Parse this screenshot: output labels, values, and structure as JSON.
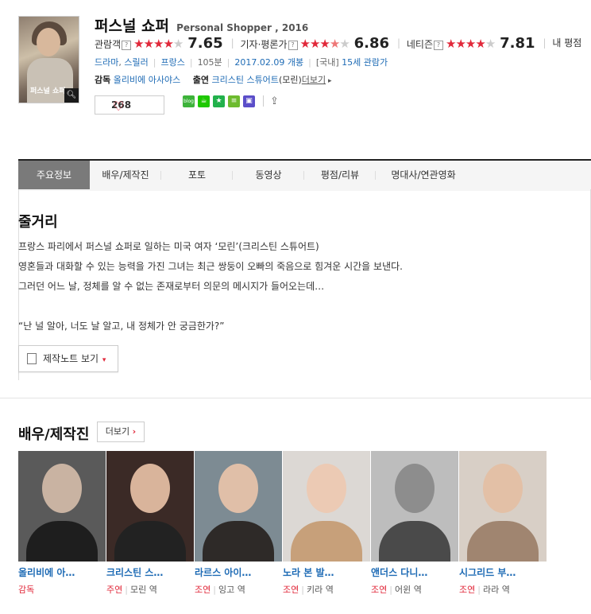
{
  "movie": {
    "title_ko": "퍼스널 쇼퍼",
    "title_en": "Personal Shopper , 2016",
    "poster_text": "퍼스널 쇼퍼"
  },
  "ratings": [
    {
      "label": "관람객",
      "stars": 4,
      "score": "7.65"
    },
    {
      "label": "기자·평론가",
      "stars": 3.5,
      "score": "6.86"
    },
    {
      "label": "네티즌",
      "stars": 4,
      "score": "7.81"
    },
    {
      "label": "내 평점"
    }
  ],
  "info": {
    "genre1": "드라마",
    "genre2": "스릴러",
    "country": "프랑스",
    "runtime": "105분",
    "release": "2017.02.09 개봉",
    "grade_prefix": "[국내]",
    "grade": "15세 관람가"
  },
  "credits": {
    "director_label": "감독",
    "director": "올리비에 아사야스",
    "cast_label": "출연",
    "cast": "크리스틴 스튜어트",
    "cast_role": "(모린)",
    "more": "더보기"
  },
  "likes": {
    "count": "268"
  },
  "share": [
    "blog",
    "cafe",
    "me",
    "band",
    "plus",
    "share"
  ],
  "tabs": [
    "주요정보",
    "배우/제작진",
    "포토",
    "동영상",
    "평점/리뷰",
    "명대사/연관영화"
  ],
  "synopsis": {
    "title": "줄거리",
    "lines": [
      "프랑스 파리에서 퍼스널 쇼퍼로 일하는 미국 여자 ‘모린’(크리스틴 스튜어트)",
      " 영혼들과 대화할 수 있는 능력을 가진 그녀는 최근 쌍둥이 오빠의 죽음으로 힘겨운 시간을 보낸다.",
      " 그러던 어느 날, 정체를 알 수 없는 존재로부터 의문의 메시지가 들어오는데…",
      "",
      " “난 널 알아, 너도 날 알고, 내 정체가 안 궁금한가?”"
    ],
    "note_button": "제작노트 보기"
  },
  "cast_section": {
    "title": "배우/제작진",
    "more": "더보기",
    "people": [
      {
        "name": "올리비에 아…",
        "type": "감독",
        "role": ""
      },
      {
        "name": "크리스틴 스…",
        "type": "주연",
        "role": "모린 역"
      },
      {
        "name": "라르스 아이…",
        "type": "조연",
        "role": "잉고 역"
      },
      {
        "name": "노라 본 발…",
        "type": "조연",
        "role": "키라 역"
      },
      {
        "name": "앤더스 다니…",
        "type": "조연",
        "role": "어윈 역"
      },
      {
        "name": "시그리드 부…",
        "type": "조연",
        "role": "라라 역"
      }
    ]
  },
  "colors": {
    "accent": "#e1283a",
    "link": "#1e6bb5",
    "tab_active": "#7a7a7a"
  }
}
